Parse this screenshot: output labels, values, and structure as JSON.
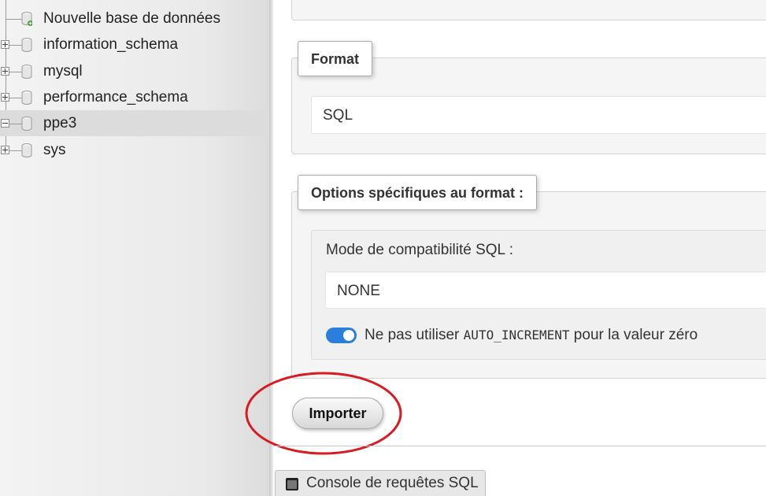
{
  "sidebar": {
    "items": [
      {
        "label": "Nouvelle base de données",
        "icon": "new-database-icon",
        "expander": "none"
      },
      {
        "label": "information_schema",
        "icon": "database-icon",
        "expander": "plus"
      },
      {
        "label": "mysql",
        "icon": "database-icon",
        "expander": "plus"
      },
      {
        "label": "performance_schema",
        "icon": "database-icon",
        "expander": "plus"
      },
      {
        "label": "ppe3",
        "icon": "database-icon",
        "expander": "minus",
        "active": true
      },
      {
        "label": "sys",
        "icon": "database-icon",
        "expander": "plus"
      }
    ]
  },
  "format": {
    "legend": "Format",
    "selected": "SQL"
  },
  "options": {
    "legend": "Options spécifiques au format :",
    "compat_label": "Mode de compatibilité SQL :",
    "compat_selected": "NONE",
    "toggle_enabled": true,
    "toggle_text_before": "Ne pas utiliser ",
    "toggle_code": "AUTO_INCREMENT",
    "toggle_text_after": " pour la valeur zéro"
  },
  "actions": {
    "import_label": "Importer"
  },
  "console": {
    "label": "Console de requêtes SQL"
  },
  "colors": {
    "toggle_on": "#2a7fdb",
    "annotation_circle": "#d81b20"
  }
}
